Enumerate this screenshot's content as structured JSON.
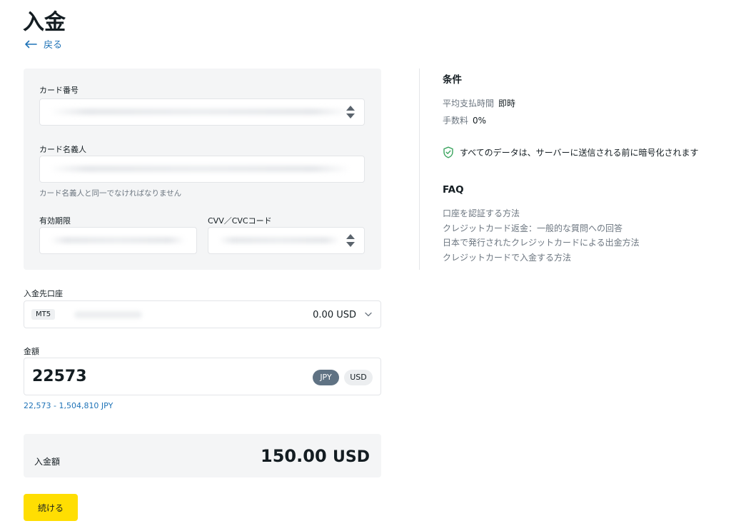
{
  "page": {
    "title": "入金",
    "back_label": "戻る"
  },
  "card_form": {
    "card_number_label": "カード番号",
    "cardholder_label": "カード名義人",
    "cardholder_hint": "カード名義人と同一でなければなりません",
    "expiry_label": "有効期限",
    "cvv_label": "CVV／CVCコード"
  },
  "account": {
    "label": "入金先口座",
    "type_badge": "MT5",
    "balance": "0.00 USD"
  },
  "amount": {
    "label": "金額",
    "value": "22573",
    "currency_options": [
      "JPY",
      "USD"
    ],
    "selected_currency": "JPY",
    "range": "22,573 - 1,504,810 JPY"
  },
  "total": {
    "label": "入金額",
    "value": "150.00",
    "currency": "USD"
  },
  "continue_label": "続ける",
  "sidebar": {
    "conditions_heading": "条件",
    "processing_time_label": "平均支払時間",
    "processing_time_value": "即時",
    "fee_label": "手数料",
    "fee_value": "0%",
    "security_note": "すべてのデータは、サーバーに送信される前に暗号化されます",
    "faq_heading": "FAQ",
    "faq_items": [
      "口座を認証する方法",
      "クレジットカード返金：一般的な質問への回答",
      "日本で発行されたクレジットカードによる出金方法",
      "クレジットカードで入金する方法"
    ]
  },
  "colors": {
    "accent_yellow": "#ffde02",
    "link_blue": "#1f73b7",
    "secure_green": "#3aa45e",
    "selected_chip": "#5f7283"
  }
}
